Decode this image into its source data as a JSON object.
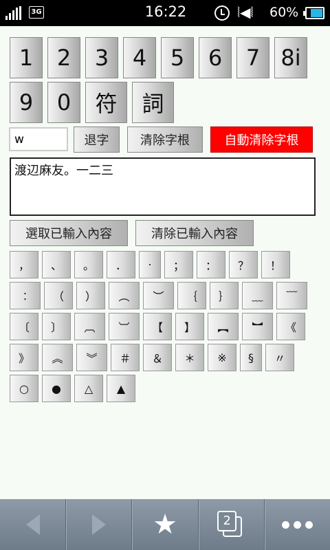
{
  "status_bar": {
    "network": "3G",
    "time": "16:22",
    "battery_percent": "60%",
    "battery_level": 0.6
  },
  "number_keys": {
    "row1": [
      "1",
      "2",
      "3",
      "4",
      "5",
      "6",
      "7",
      "8i"
    ],
    "row2": [
      "9",
      "0",
      "符",
      "詞"
    ]
  },
  "input_row": {
    "roots_value": "w",
    "backspace_label": "退字",
    "clear_roots_label": "清除字根",
    "auto_clear_label": "自動清除字根",
    "auto_clear_color": "#ff0000"
  },
  "output_text": "渡辺麻友。一二三",
  "actions": {
    "select_all_label": "選取已輸入內容",
    "clear_all_label": "清除已輸入內容"
  },
  "punctuation_rows": [
    [
      "，",
      "、",
      "。",
      "．",
      "‧",
      "；",
      "：",
      "？",
      "！"
    ],
    [
      "︰",
      "（",
      "）",
      "︵",
      "︶",
      "｛",
      "｝",
      "﹏",
      "﹋"
    ],
    [
      "〔",
      "〕",
      "︹",
      "︺",
      "【",
      "】",
      "︻",
      "︼",
      "《"
    ],
    [
      "》",
      "︽",
      "︾",
      "＃",
      "＆",
      "＊",
      "※",
      "§",
      "〃"
    ],
    [
      "○",
      "●",
      "△",
      "▲"
    ]
  ],
  "bottom_bar": {
    "back_icon": "back-arrow-icon",
    "forward_icon": "forward-arrow-icon",
    "bookmark_icon": "star-icon",
    "tabs_count": "2",
    "menu_icon": "more-dots-icon"
  }
}
